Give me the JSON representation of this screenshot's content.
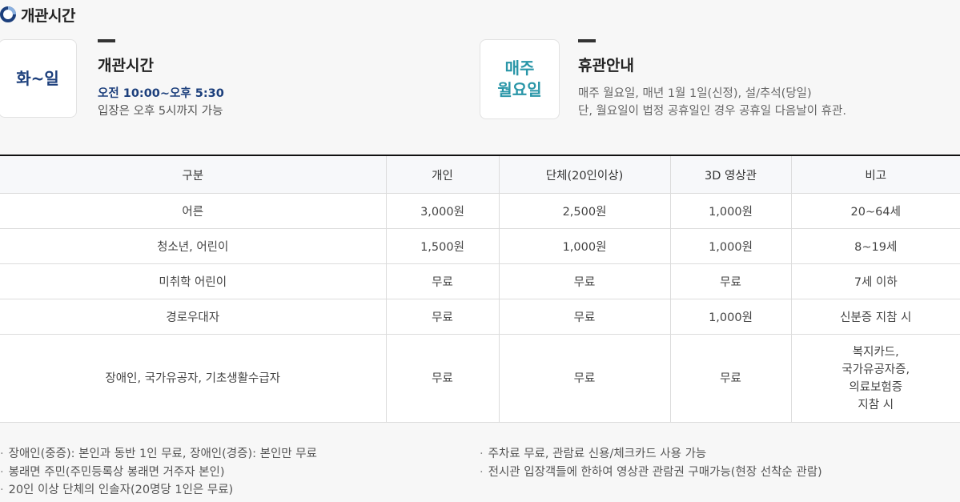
{
  "section_title": "개관시간",
  "opening": {
    "box_label": "화~일",
    "heading": "개관시간",
    "hours": "오전 10:00~오후 5:30",
    "note": "입장은 오후 5시까지 가능"
  },
  "closed": {
    "box_line1": "매주",
    "box_line2": "월요일",
    "heading": "휴관안내",
    "line1": "매주 월요일, 매년 1월 1일(신정), 설/추석(당일)",
    "line2": "단, 월요일이 법정 공휴일인 경우 공휴일 다음날이 휴관."
  },
  "fee_table": {
    "headers": [
      "구분",
      "개인",
      "단체(20인이상)",
      "3D 영상관",
      "비고"
    ],
    "rows": [
      [
        "어른",
        "3,000원",
        "2,500원",
        "1,000원",
        "20~64세"
      ],
      [
        "청소년, 어린이",
        "1,500원",
        "1,000원",
        "1,000원",
        "8~19세"
      ],
      [
        "미취학 어린이",
        "무료",
        "무료",
        "무료",
        "7세 이하"
      ],
      [
        "경로우대자",
        "무료",
        "무료",
        "1,000원",
        "신분증 지참 시"
      ],
      [
        "장애인, 국가유공자, 기초생활수급자",
        "무료",
        "무료",
        "무료",
        [
          "복지카드,",
          "국가유공자증,",
          "의료보험증",
          "지참 시"
        ]
      ]
    ]
  },
  "notes_left": [
    "장애인(중증): 본인과 동반 1인 무료, 장애인(경증): 본인만 무료",
    "봉래면 주민(주민등록상 봉래면 거주자 본인)",
    "20인 이상 단체의 인솔자(20명당 1인은 무료)"
  ],
  "notes_right": [
    "주차료 무료, 관람료 신용/체크카드 사용 가능",
    "전시관 입장객들에 한하여 영상관 관람권 구매가능(현장 선착순 관람)"
  ]
}
